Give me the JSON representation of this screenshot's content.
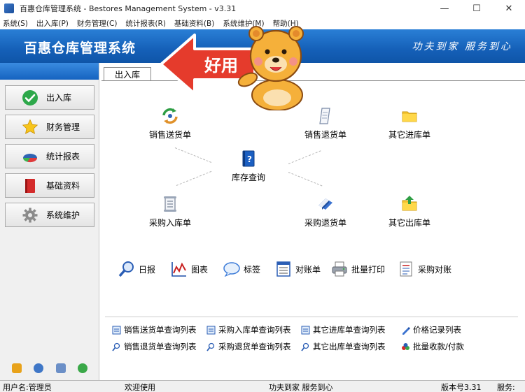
{
  "window": {
    "title": "百惠仓库管理系统 - Bestores Management System - v3.31",
    "controls": [
      "minimize",
      "maximize",
      "close"
    ]
  },
  "menu": [
    "系统(S)",
    "出入库(P)",
    "财务管理(C)",
    "统计报表(R)",
    "基础资料(B)",
    "系统维护(M)",
    "帮助(H)"
  ],
  "banner": {
    "title": "百惠仓库管理系统",
    "slogan": "功夫到家 服务到心"
  },
  "sidebar": {
    "items": [
      {
        "label": "出入库",
        "icon": "check-icon"
      },
      {
        "label": "财务管理",
        "icon": "star-icon"
      },
      {
        "label": "统计报表",
        "icon": "pie-chart-icon"
      },
      {
        "label": "基础资料",
        "icon": "book-icon"
      },
      {
        "label": "系统维护",
        "icon": "gear-icon"
      }
    ],
    "footer_icons": [
      "key-icon",
      "clock-icon",
      "search-icon",
      "back-icon"
    ]
  },
  "tab": {
    "label": "出入库"
  },
  "flow": {
    "sales_delivery": "销售送货单",
    "sales_return": "销售退货单",
    "other_in": "其它进库单",
    "inventory_query": "库存查询",
    "purchase_in": "采购入库单",
    "purchase_return": "采购退货单",
    "other_out": "其它出库单"
  },
  "toolbar": {
    "daily": "日报",
    "chart": "图表",
    "label": "标签",
    "statement": "对账单",
    "batch_print": "批量打印",
    "purchase_statement": "采购对账"
  },
  "links": {
    "row1": [
      "销售送货单查询列表",
      "采购入库单查询列表",
      "其它进库单查询列表",
      "价格记录列表"
    ],
    "row2": [
      "销售退货单查询列表",
      "采购退货单查询列表",
      "其它出库单查询列表",
      "批量收款/付款"
    ]
  },
  "sticker": {
    "text": "好用"
  },
  "status": {
    "user": "用户名:管理员",
    "welcome": "欢迎使用",
    "slogan": "功夫到家 服务到心",
    "version": "版本号3.31",
    "service": "服务:"
  },
  "colors": {
    "banner": "#1560b8",
    "accent_red": "#e53b2c",
    "bear": "#f5b03a"
  }
}
